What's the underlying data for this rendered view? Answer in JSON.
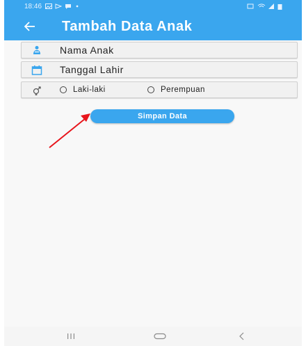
{
  "status_bar": {
    "time": "18:46"
  },
  "app_bar": {
    "title": "Tambah Data Anak",
    "back_icon": "arrow-left-icon"
  },
  "form": {
    "name_placeholder": "Nama Anak",
    "birthdate_placeholder": "Tanggal Lahir",
    "gender": {
      "male_label": "Laki-laki",
      "female_label": "Perempuan",
      "selected": null
    },
    "save_label": "Simpan Data"
  },
  "colors": {
    "accent": "#3aa6ee",
    "annotation_arrow": "#e8141b"
  },
  "nav": {
    "recent_icon": "recent-apps-icon",
    "home_icon": "home-icon",
    "back_icon": "nav-back-icon"
  }
}
